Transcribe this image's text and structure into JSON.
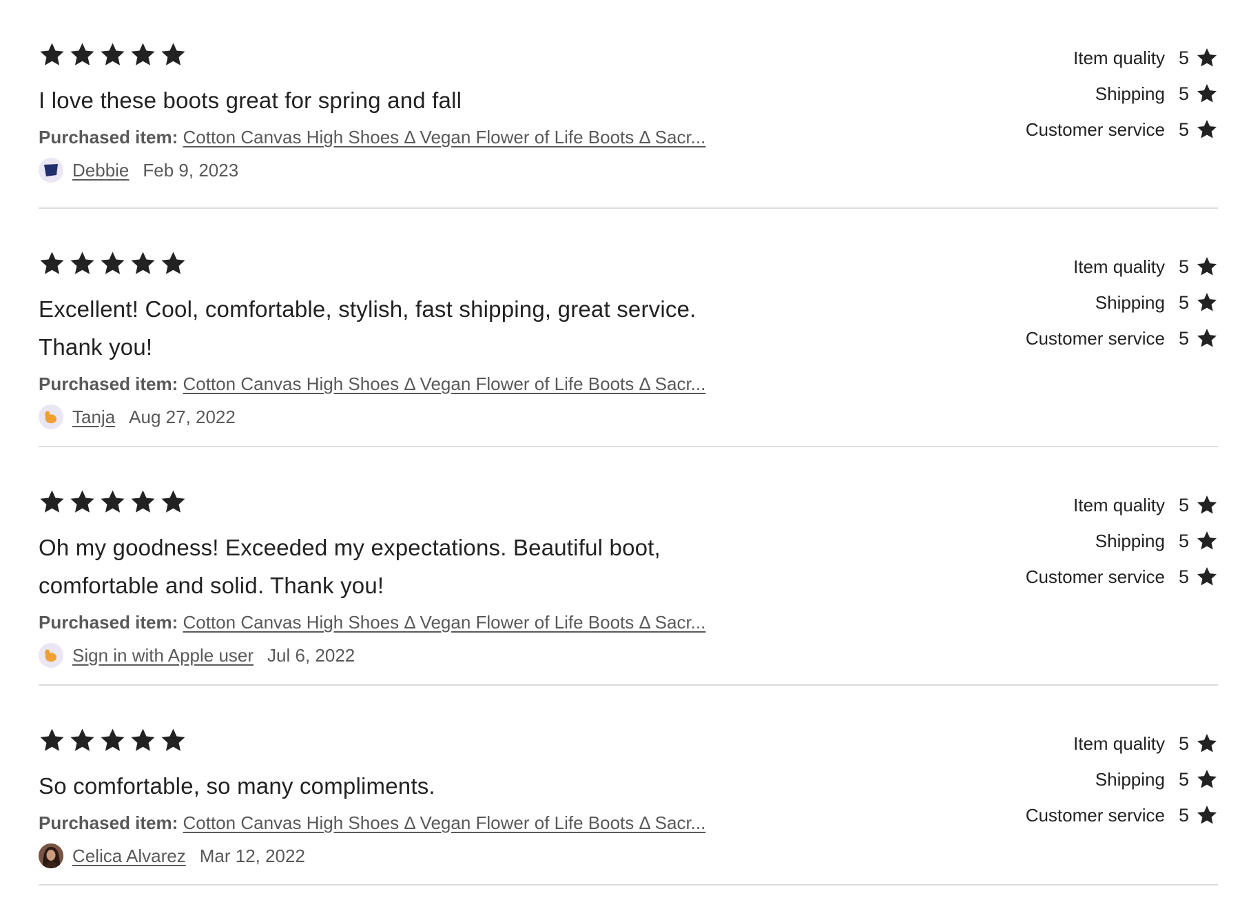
{
  "reviews": [
    {
      "stars": 5,
      "text": "I love these boots great for spring and fall",
      "purchased_label": "Purchased item:",
      "item": "Cotton Canvas High Shoes Δ Vegan Flower of Life Boots Δ Sacr...",
      "reviewer": "Debbie",
      "date": "Feb 9, 2023",
      "avatar_icon": "blue-shape-icon",
      "ratings": [
        {
          "label": "Item quality",
          "value": "5"
        },
        {
          "label": "Shipping",
          "value": "5"
        },
        {
          "label": "Customer service",
          "value": "5"
        }
      ]
    },
    {
      "stars": 5,
      "text": "Excellent! Cool, comfortable, stylish, fast shipping, great service. Thank you!",
      "purchased_label": "Purchased item:",
      "item": "Cotton Canvas High Shoes Δ Vegan Flower of Life Boots Δ Sacr...",
      "reviewer": "Tanja",
      "date": "Aug 27, 2022",
      "avatar_icon": "orange-shape-icon",
      "ratings": [
        {
          "label": "Item quality",
          "value": "5"
        },
        {
          "label": "Shipping",
          "value": "5"
        },
        {
          "label": "Customer service",
          "value": "5"
        }
      ]
    },
    {
      "stars": 5,
      "text": "Oh my goodness! Exceeded my expectations. Beautiful boot, comfortable and solid. Thank you!",
      "purchased_label": "Purchased item:",
      "item": "Cotton Canvas High Shoes Δ Vegan Flower of Life Boots Δ Sacr...",
      "reviewer": "Sign in with Apple user",
      "date": "Jul 6, 2022",
      "avatar_icon": "orange-shape-icon",
      "ratings": [
        {
          "label": "Item quality",
          "value": "5"
        },
        {
          "label": "Shipping",
          "value": "5"
        },
        {
          "label": "Customer service",
          "value": "5"
        }
      ]
    },
    {
      "stars": 5,
      "text": "So comfortable, so many compliments.",
      "purchased_label": "Purchased item:",
      "item": "Cotton Canvas High Shoes Δ Vegan Flower of Life Boots Δ Sacr...",
      "reviewer": "Celica Alvarez",
      "date": "Mar 12, 2022",
      "avatar_icon": "profile-photo",
      "ratings": [
        {
          "label": "Item quality",
          "value": "5"
        },
        {
          "label": "Shipping",
          "value": "5"
        },
        {
          "label": "Customer service",
          "value": "5"
        }
      ]
    }
  ],
  "colors": {
    "star": "#222222",
    "text": "#222222",
    "muted": "#595959",
    "divider": "#dcdcdc",
    "avatar_bg": "#eae6f4",
    "avatar_blue": "#1f2f6e",
    "avatar_orange": "#f0a030"
  }
}
